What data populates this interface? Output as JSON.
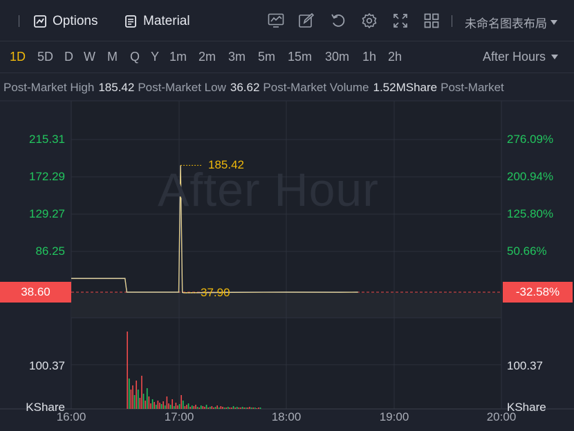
{
  "toolbar": {
    "options_label": "Options",
    "material_label": "Material",
    "layout_label": "未命名图表布局",
    "icons": [
      "indicator-icon",
      "draw-icon",
      "reset-icon",
      "settings-icon",
      "fullscreen-icon",
      "layout-grid-icon"
    ]
  },
  "periods": {
    "items": [
      "1D",
      "5D",
      "D",
      "W",
      "M",
      "Q",
      "Y",
      "1m",
      "2m",
      "3m",
      "5m",
      "15m",
      "30m",
      "1h",
      "2h"
    ],
    "active": "1D",
    "session_label": "After Hours"
  },
  "info": {
    "high_key": "Post-Market High",
    "high_val": "185.42",
    "low_key": "Post-Market Low",
    "low_val": "36.62",
    "volume_key": "Post-Market Volume",
    "volume_val": "1.52MShare",
    "extra_key": "Post-Market"
  },
  "chart": {
    "watermark": "After Hour",
    "left_ticks": [
      "215.31",
      "172.29",
      "129.27",
      "86.25"
    ],
    "right_ticks": [
      "276.09%",
      "200.94%",
      "125.80%",
      "50.66%"
    ],
    "current_price": "38.60",
    "current_change": "-32.58%",
    "high_marker": "185.42",
    "low_marker": "37.90",
    "volume_tick": "100.37",
    "volume_unit": "KShare",
    "x_labels": [
      "16:00",
      "17:00",
      "18:00",
      "19:00",
      "20:00"
    ],
    "colors": {
      "up": "#22c55e",
      "down": "#f24c4c",
      "accent": "#f0b90b",
      "line": "#dfe2e8"
    }
  },
  "chart_data": {
    "type": "line",
    "x": [
      "16:00",
      "16:30",
      "16:31",
      "17:00",
      "17:01",
      "17:02",
      "17:03",
      "17:30",
      "18:00",
      "18:30",
      "18:40"
    ],
    "y": [
      54.5,
      54.5,
      38.6,
      38.6,
      185.42,
      38.3,
      37.9,
      38.4,
      38.6,
      38.5,
      38.6
    ],
    "ylim": [
      36.62,
      215.31
    ],
    "xlim": [
      "16:00",
      "20:00"
    ],
    "grid": true
  }
}
